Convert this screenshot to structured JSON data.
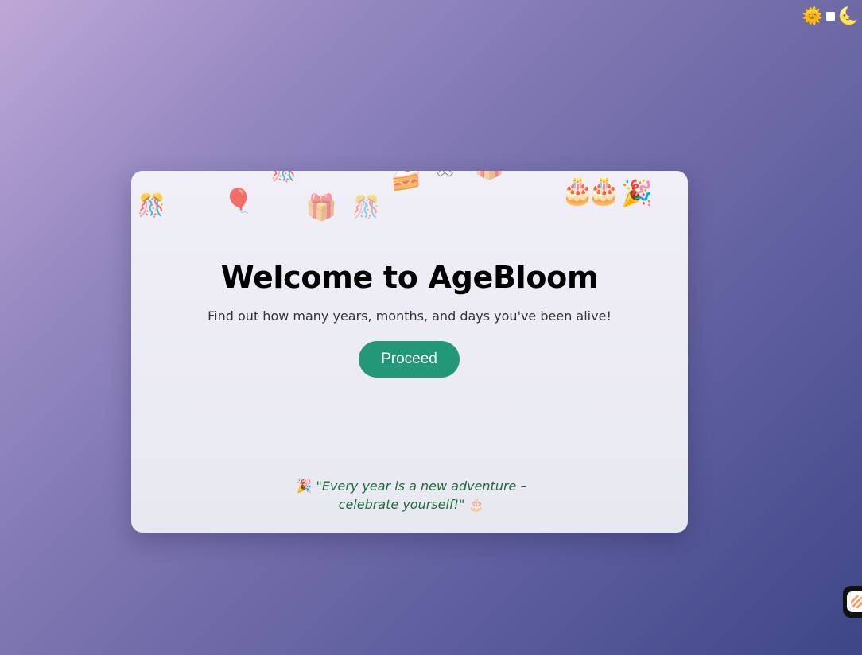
{
  "theme_toggle": {
    "sun_icon": "🌞",
    "moon_icon": "🌜"
  },
  "welcome": {
    "title": "Welcome to AgeBloom",
    "subtitle": "Find out how many years, months, and days you've been alive!",
    "proceed_label": "Proceed",
    "quote_prefix_emoji": "🎉",
    "quote_text": "\"Every year is a new adventure – celebrate yourself!\"",
    "quote_suffix_emoji": "🎂"
  },
  "decorations": {
    "confetti_ball": "🎊",
    "balloon": "🎈",
    "gift": "🎁",
    "cake_slice": "🍰",
    "cake": "🎂",
    "party_popper": "🎉",
    "ribbon": "🎗"
  },
  "colors": {
    "accent": "#229879",
    "quote": "#1e6b3a"
  }
}
